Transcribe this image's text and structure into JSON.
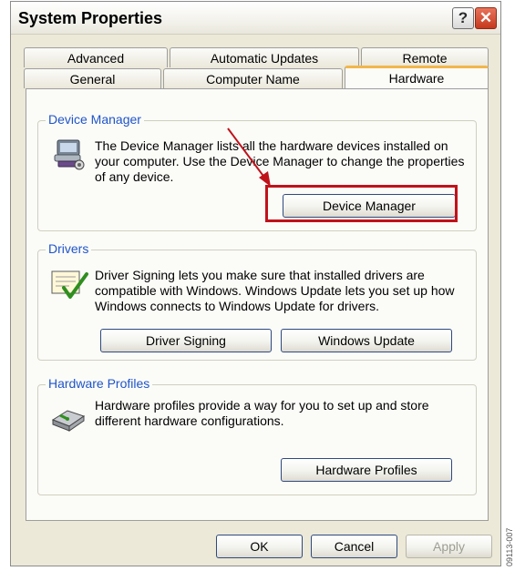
{
  "window": {
    "title": "System Properties",
    "help_glyph": "?",
    "close_glyph": "✕"
  },
  "tabs": {
    "row1": [
      {
        "label": "Advanced"
      },
      {
        "label": "Automatic Updates"
      },
      {
        "label": "Remote"
      }
    ],
    "row2": [
      {
        "label": "General"
      },
      {
        "label": "Computer Name"
      },
      {
        "label": "Hardware",
        "selected": true
      }
    ]
  },
  "device_manager": {
    "label": "Device Manager",
    "description": "The Device Manager lists all the hardware devices installed on your computer. Use the Device Manager to change the properties of any device.",
    "button": "Device Manager",
    "icon": "device-manager-icon"
  },
  "drivers": {
    "label": "Drivers",
    "description": "Driver Signing lets you make sure that installed drivers are compatible with Windows. Windows Update lets you set up how Windows connects to Windows Update for drivers.",
    "signing_button": "Driver Signing",
    "update_button": "Windows Update",
    "icon": "driver-signing-icon"
  },
  "hardware_profiles": {
    "label": "Hardware Profiles",
    "description": "Hardware profiles provide a way for you to set up and store different hardware configurations.",
    "button": "Hardware Profiles",
    "icon": "hardware-profiles-icon"
  },
  "footer": {
    "ok": "OK",
    "cancel": "Cancel",
    "apply": "Apply"
  },
  "annotation": {
    "highlight_color": "#c0121a",
    "side_code": "09113-007"
  },
  "colors": {
    "group_label": "#1f55c9",
    "selected_tab_accent": "#f2b64a",
    "close_button": "#c5391f"
  }
}
